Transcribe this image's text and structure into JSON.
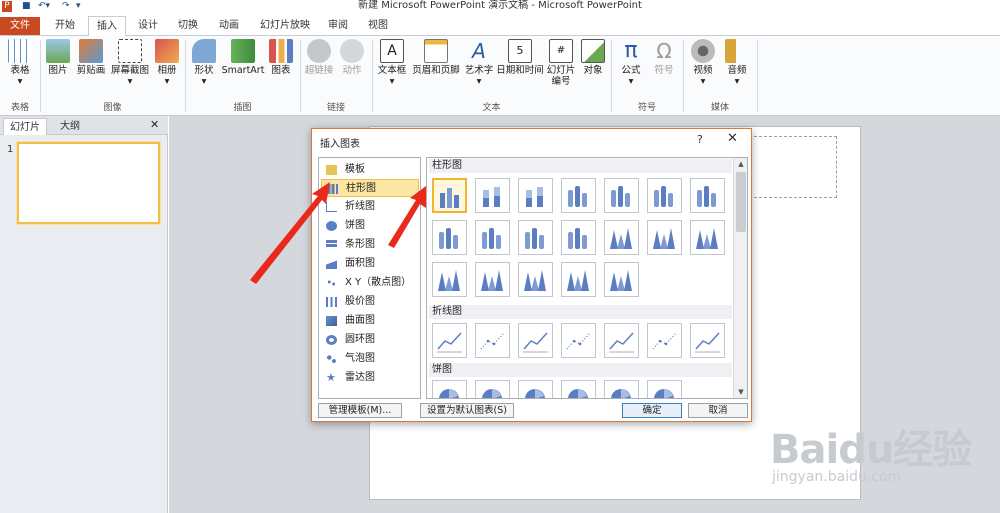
{
  "window": {
    "title": "新建 Microsoft PowerPoint 演示文稿 - Microsoft PowerPoint"
  },
  "tabs": [
    "文件",
    "开始",
    "插入",
    "设计",
    "切换",
    "动画",
    "幻灯片放映",
    "审阅",
    "视图"
  ],
  "active_tab": "插入",
  "ribbon": {
    "buttons": [
      "表格",
      "图片",
      "剪贴画",
      "屏幕截图",
      "相册",
      "形状",
      "SmartArt",
      "图表",
      "超链接",
      "动作",
      "文本框",
      "页眉和页脚",
      "艺术字",
      "日期和时间",
      "幻灯片编号",
      "对象",
      "公式",
      "符号",
      "视频",
      "音频"
    ],
    "groups": [
      "表格",
      "图像",
      "插图",
      "链接",
      "文本",
      "符号",
      "媒体"
    ]
  },
  "left_pane": {
    "tabs": [
      "幻灯片",
      "大纲"
    ],
    "close": "✕",
    "slide_number": "1"
  },
  "dialog": {
    "title": "插入图表",
    "help": "?",
    "close": "✕",
    "types": [
      "模板",
      "柱形图",
      "折线图",
      "饼图",
      "条形图",
      "面积图",
      "X Y（散点图）",
      "股价图",
      "曲面图",
      "圆环图",
      "气泡图",
      "雷达图"
    ],
    "selected_type": "柱形图",
    "sections": [
      "柱形图",
      "折线图",
      "饼图"
    ],
    "buttons": {
      "manage": "管理模板(M)...",
      "set_default": "设置为默认图表(S)",
      "ok": "确定",
      "cancel": "取消"
    }
  },
  "watermark": {
    "brand": "Baidu经验",
    "url": "jingyan.baidu.com"
  },
  "colors": {
    "accent": "#c94a20",
    "selection": "#f2c04a",
    "arrow": "#e8291c",
    "chart_blue": "#5b7ec2"
  }
}
